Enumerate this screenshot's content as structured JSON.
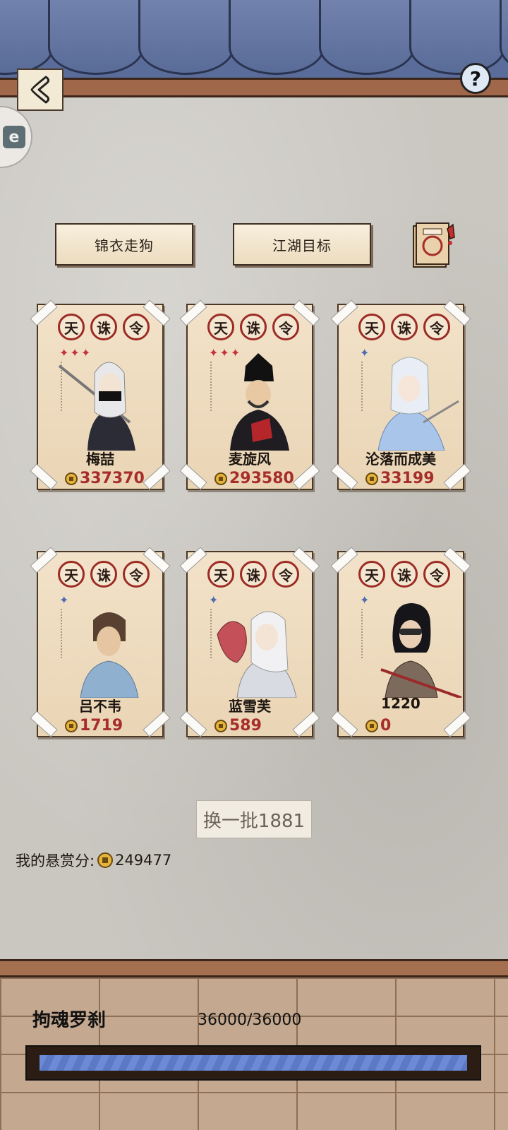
{
  "header": {
    "back_icon": "chevron-left-icon",
    "help_label": "?"
  },
  "side_tab_label": "e",
  "tabs": {
    "left_label": "锦衣走狗",
    "right_label": "江湖目标"
  },
  "seal_labels": [
    "天",
    "诛",
    "令"
  ],
  "cards": [
    {
      "name": "梅喆",
      "score": "337370",
      "stars": "✦✦✦",
      "star_color": "red"
    },
    {
      "name": "麦旋风",
      "score": "293580",
      "stars": "✦✦✦",
      "star_color": "red"
    },
    {
      "name": "沦落而成美",
      "score": "33199",
      "stars": "✦",
      "star_color": "blue"
    },
    {
      "name": "吕不韦",
      "score": "1719",
      "stars": "✦",
      "star_color": "blue"
    },
    {
      "name": "蓝雪芙",
      "score": "589",
      "stars": "✦",
      "star_color": "blue"
    },
    {
      "name": "1220",
      "score": "0",
      "stars": "✦",
      "star_color": "blue"
    }
  ],
  "refresh_label": "换一批1881",
  "bounty": {
    "label": "我的悬赏分:",
    "value": "249477"
  },
  "boss": {
    "name": "拘魂罗刹",
    "hp_text": "36000/36000",
    "hp_fraction": 1.0
  },
  "colors": {
    "roof": "#5a6d9a",
    "beam": "#a0674a",
    "score_red": "#a62d2a",
    "hp_blue": "#6d8ad6"
  }
}
